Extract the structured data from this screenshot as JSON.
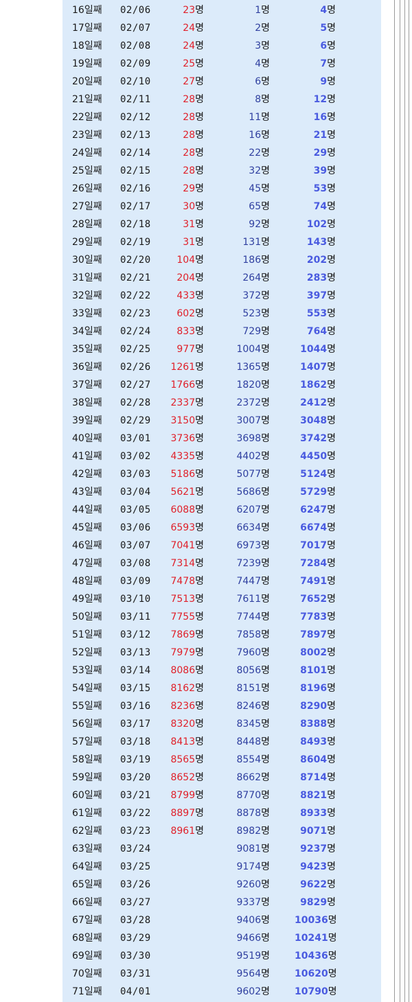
{
  "unit": "명",
  "colors": {
    "panel": "#dcebfa",
    "confirmed": "#e0202a",
    "second": "#3040a0",
    "third": "#4a5be0"
  },
  "rows": [
    {
      "day": "16일째",
      "date": "02/06",
      "a": "23",
      "b": "1",
      "c": "4"
    },
    {
      "day": "17일째",
      "date": "02/07",
      "a": "24",
      "b": "2",
      "c": "5"
    },
    {
      "day": "18일째",
      "date": "02/08",
      "a": "24",
      "b": "3",
      "c": "6"
    },
    {
      "day": "19일째",
      "date": "02/09",
      "a": "25",
      "b": "4",
      "c": "7"
    },
    {
      "day": "20일째",
      "date": "02/10",
      "a": "27",
      "b": "6",
      "c": "9"
    },
    {
      "day": "21일째",
      "date": "02/11",
      "a": "28",
      "b": "8",
      "c": "12"
    },
    {
      "day": "22일째",
      "date": "02/12",
      "a": "28",
      "b": "11",
      "c": "16"
    },
    {
      "day": "23일째",
      "date": "02/13",
      "a": "28",
      "b": "16",
      "c": "21"
    },
    {
      "day": "24일째",
      "date": "02/14",
      "a": "28",
      "b": "22",
      "c": "29"
    },
    {
      "day": "25일째",
      "date": "02/15",
      "a": "28",
      "b": "32",
      "c": "39"
    },
    {
      "day": "26일째",
      "date": "02/16",
      "a": "29",
      "b": "45",
      "c": "53"
    },
    {
      "day": "27일째",
      "date": "02/17",
      "a": "30",
      "b": "65",
      "c": "74"
    },
    {
      "day": "28일째",
      "date": "02/18",
      "a": "31",
      "b": "92",
      "c": "102"
    },
    {
      "day": "29일째",
      "date": "02/19",
      "a": "31",
      "b": "131",
      "c": "143"
    },
    {
      "day": "30일째",
      "date": "02/20",
      "a": "104",
      "b": "186",
      "c": "202"
    },
    {
      "day": "31일째",
      "date": "02/21",
      "a": "204",
      "b": "264",
      "c": "283"
    },
    {
      "day": "32일째",
      "date": "02/22",
      "a": "433",
      "b": "372",
      "c": "397"
    },
    {
      "day": "33일째",
      "date": "02/23",
      "a": "602",
      "b": "523",
      "c": "553"
    },
    {
      "day": "34일째",
      "date": "02/24",
      "a": "833",
      "b": "729",
      "c": "764"
    },
    {
      "day": "35일째",
      "date": "02/25",
      "a": "977",
      "b": "1004",
      "c": "1044"
    },
    {
      "day": "36일째",
      "date": "02/26",
      "a": "1261",
      "b": "1365",
      "c": "1407"
    },
    {
      "day": "37일째",
      "date": "02/27",
      "a": "1766",
      "b": "1820",
      "c": "1862"
    },
    {
      "day": "38일째",
      "date": "02/28",
      "a": "2337",
      "b": "2372",
      "c": "2412"
    },
    {
      "day": "39일째",
      "date": "02/29",
      "a": "3150",
      "b": "3007",
      "c": "3048"
    },
    {
      "day": "40일째",
      "date": "03/01",
      "a": "3736",
      "b": "3698",
      "c": "3742"
    },
    {
      "day": "41일째",
      "date": "03/02",
      "a": "4335",
      "b": "4402",
      "c": "4450"
    },
    {
      "day": "42일째",
      "date": "03/03",
      "a": "5186",
      "b": "5077",
      "c": "5124"
    },
    {
      "day": "43일째",
      "date": "03/04",
      "a": "5621",
      "b": "5686",
      "c": "5729"
    },
    {
      "day": "44일째",
      "date": "03/05",
      "a": "6088",
      "b": "6207",
      "c": "6247"
    },
    {
      "day": "45일째",
      "date": "03/06",
      "a": "6593",
      "b": "6634",
      "c": "6674"
    },
    {
      "day": "46일째",
      "date": "03/07",
      "a": "7041",
      "b": "6973",
      "c": "7017"
    },
    {
      "day": "47일째",
      "date": "03/08",
      "a": "7314",
      "b": "7239",
      "c": "7284"
    },
    {
      "day": "48일째",
      "date": "03/09",
      "a": "7478",
      "b": "7447",
      "c": "7491"
    },
    {
      "day": "49일째",
      "date": "03/10",
      "a": "7513",
      "b": "7611",
      "c": "7652"
    },
    {
      "day": "50일째",
      "date": "03/11",
      "a": "7755",
      "b": "7744",
      "c": "7783"
    },
    {
      "day": "51일째",
      "date": "03/12",
      "a": "7869",
      "b": "7858",
      "c": "7897"
    },
    {
      "day": "52일째",
      "date": "03/13",
      "a": "7979",
      "b": "7960",
      "c": "8002"
    },
    {
      "day": "53일째",
      "date": "03/14",
      "a": "8086",
      "b": "8056",
      "c": "8101"
    },
    {
      "day": "54일째",
      "date": "03/15",
      "a": "8162",
      "b": "8151",
      "c": "8196"
    },
    {
      "day": "55일째",
      "date": "03/16",
      "a": "8236",
      "b": "8246",
      "c": "8290"
    },
    {
      "day": "56일째",
      "date": "03/17",
      "a": "8320",
      "b": "8345",
      "c": "8388"
    },
    {
      "day": "57일째",
      "date": "03/18",
      "a": "8413",
      "b": "8448",
      "c": "8493"
    },
    {
      "day": "58일째",
      "date": "03/19",
      "a": "8565",
      "b": "8554",
      "c": "8604"
    },
    {
      "day": "59일째",
      "date": "03/20",
      "a": "8652",
      "b": "8662",
      "c": "8714"
    },
    {
      "day": "60일째",
      "date": "03/21",
      "a": "8799",
      "b": "8770",
      "c": "8821"
    },
    {
      "day": "61일째",
      "date": "03/22",
      "a": "8897",
      "b": "8878",
      "c": "8933"
    },
    {
      "day": "62일째",
      "date": "03/23",
      "a": "8961",
      "b": "8982",
      "c": "9071"
    },
    {
      "day": "63일째",
      "date": "03/24",
      "a": "",
      "b": "9081",
      "c": "9237"
    },
    {
      "day": "64일째",
      "date": "03/25",
      "a": "",
      "b": "9174",
      "c": "9423"
    },
    {
      "day": "65일째",
      "date": "03/26",
      "a": "",
      "b": "9260",
      "c": "9622"
    },
    {
      "day": "66일째",
      "date": "03/27",
      "a": "",
      "b": "9337",
      "c": "9829"
    },
    {
      "day": "67일째",
      "date": "03/28",
      "a": "",
      "b": "9406",
      "c": "10036"
    },
    {
      "day": "68일째",
      "date": "03/29",
      "a": "",
      "b": "9466",
      "c": "10241"
    },
    {
      "day": "69일째",
      "date": "03/30",
      "a": "",
      "b": "9519",
      "c": "10436"
    },
    {
      "day": "70일째",
      "date": "03/31",
      "a": "",
      "b": "9564",
      "c": "10620"
    },
    {
      "day": "71일째",
      "date": "04/01",
      "a": "",
      "b": "9602",
      "c": "10790"
    }
  ]
}
